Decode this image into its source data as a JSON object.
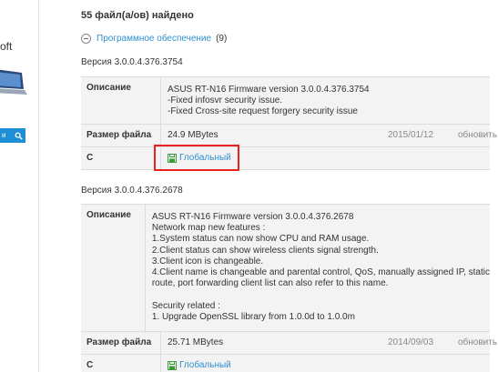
{
  "sidebar": {
    "cut_text": "oft",
    "search_button_text": "и"
  },
  "results": {
    "count_text": "55 файл(а/ов) найдено"
  },
  "category": {
    "name": "Программное обеспечение",
    "count": "(9)"
  },
  "firmwares": [
    {
      "version": "Версия 3.0.0.4.376.3754",
      "description_label": "Описание",
      "description": [
        "ASUS RT-N16 Firmware version 3.0.0.4.376.3754",
        "-Fixed infosvr security issue.",
        "-Fixed Cross-site request forgery security issue"
      ],
      "size_label": "Размер файла",
      "size": "24.9 MBytes",
      "date": "2015/01/12",
      "refresh": "обновить",
      "from_label": "С",
      "download": "Глобальный"
    },
    {
      "version": "Версия 3.0.0.4.376.2678",
      "description_label": "Описание",
      "description": [
        "ASUS RT-N16 Firmware version 3.0.0.4.376.2678",
        "Network map new features :",
        "1.System status can now show CPU and RAM usage.",
        "2.Client status can show wireless clients signal strength.",
        "3.Client icon is changeable.",
        "4.Client name is changeable and parental control, QoS, manually assigned IP, static",
        "route, port forwarding client list can also refer to this name.",
        "",
        "Security related :",
        "1. Upgrade OpenSSL library from 1.0.0d to 1.0.0m"
      ],
      "size_label": "Размер файла",
      "size": "25.71 MBytes",
      "date": "2014/09/03",
      "refresh": "обновить",
      "from_label": "С",
      "download": "Глобальный"
    }
  ],
  "colors": {
    "link": "#2f8fd0",
    "highlight": "#e8221c",
    "table_bg": "#f3f3f3"
  }
}
